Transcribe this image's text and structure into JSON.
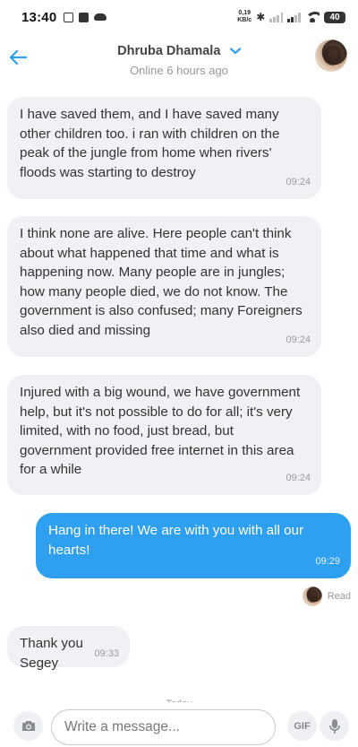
{
  "status_bar": {
    "time": "13:40",
    "net_speed_value": "0,19",
    "net_speed_unit": "KB/c",
    "battery": "40",
    "bluetooth": "✱",
    "icons": [
      "gallery-icon",
      "app-icon",
      "cloud-icon",
      "bluetooth-icon",
      "signal-icon",
      "wifi-icon",
      "battery-icon"
    ]
  },
  "header": {
    "contact_name": "Dhruba Dhamala",
    "contact_status": "Online 6 hours ago",
    "accent_color": "#2f9ff0"
  },
  "messages": [
    {
      "direction": "in",
      "text": "I have saved them, and I have saved many other children too. i ran with children on the peak of the jungle from home when rivers' floods was starting to destroy",
      "time": "09:24"
    },
    {
      "direction": "in",
      "text": "I think none are alive. Here people can't think about what happened that time and what is happening now. Many people are in jungles; how many people died, we do not know. The government is also confused; many Foreigners also died and missing",
      "time": "09:24"
    },
    {
      "direction": "in",
      "text": "Injured with a big wound, we have government help, but it's not possible to do for all; it's very limited, with no food, just bread, but government provided free internet in this area for a while",
      "time": "09:24"
    },
    {
      "direction": "out",
      "text": "Hang in there! We are with you with all our hearts!",
      "time": "09:29"
    },
    {
      "direction": "in",
      "text": "Thank you Segey",
      "time": "09:33"
    }
  ],
  "read_receipt": {
    "label": "Read"
  },
  "date_divider": {
    "label": "Today"
  },
  "input_bar": {
    "placeholder": "Write a message...",
    "gif_label": "GIF"
  }
}
